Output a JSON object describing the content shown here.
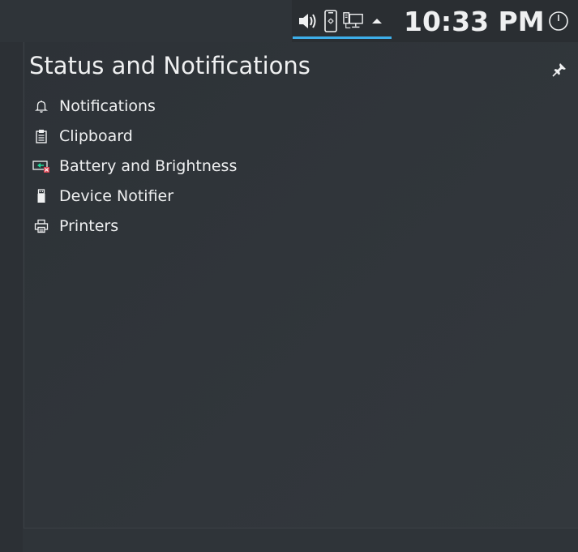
{
  "panel": {
    "clock": "10:33 PM",
    "tray_icons": [
      "volume-icon",
      "kdeconnect-phone-icon",
      "network-wired-icon",
      "expand-arrow-icon"
    ],
    "power_icon": "power-icon",
    "accent_color": "#3daee9"
  },
  "popup": {
    "title": "Status and Notifications",
    "pin_icon": "pin-icon",
    "items": [
      {
        "label": "Notifications",
        "icon": "bell-icon"
      },
      {
        "label": "Clipboard",
        "icon": "clipboard-icon"
      },
      {
        "label": "Battery and Brightness",
        "icon": "battery-icon"
      },
      {
        "label": "Device Notifier",
        "icon": "usb-drive-icon"
      },
      {
        "label": "Printers",
        "icon": "printer-icon"
      }
    ]
  }
}
